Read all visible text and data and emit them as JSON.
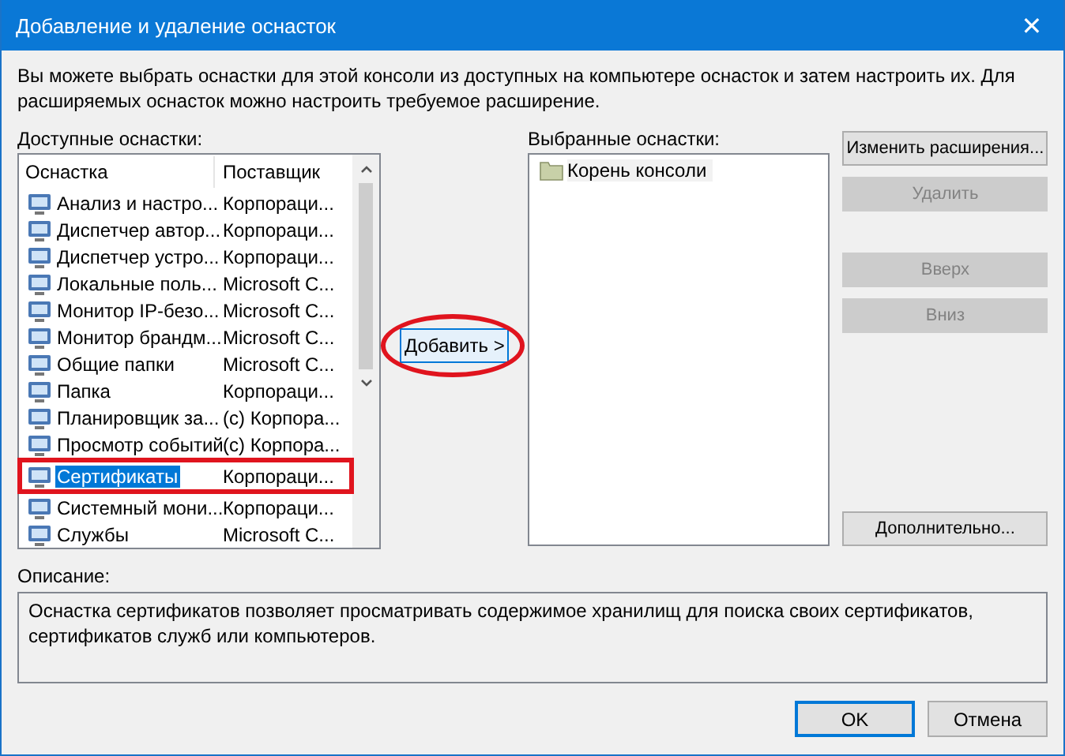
{
  "window": {
    "title": "Добавление и удаление оснасток",
    "close": "✕"
  },
  "intro": "Вы можете выбрать оснастки для этой консоли из доступных на компьютере оснасток и затем настроить их. Для расширяемых оснасток можно настроить требуемое расширение.",
  "available": {
    "label": "Доступные оснастки:",
    "columns": [
      "Оснастка",
      "Поставщик"
    ],
    "rows": [
      {
        "name": "Анализ и настро...",
        "vendor": "Корпораци...",
        "selected": false,
        "highlighted": false
      },
      {
        "name": "Диспетчер автор...",
        "vendor": "Корпораци...",
        "selected": false,
        "highlighted": false
      },
      {
        "name": "Диспетчер устро...",
        "vendor": "Корпораци...",
        "selected": false,
        "highlighted": false
      },
      {
        "name": "Локальные поль...",
        "vendor": "Microsoft C...",
        "selected": false,
        "highlighted": false
      },
      {
        "name": "Монитор IP-безо...",
        "vendor": "Microsoft C...",
        "selected": false,
        "highlighted": false
      },
      {
        "name": "Монитор брандм...",
        "vendor": "Microsoft C...",
        "selected": false,
        "highlighted": false
      },
      {
        "name": "Общие папки",
        "vendor": "Microsoft C...",
        "selected": false,
        "highlighted": false
      },
      {
        "name": "Папка",
        "vendor": "Корпораци...",
        "selected": false,
        "highlighted": false
      },
      {
        "name": "Планировщик за...",
        "vendor": "(c) Корпора...",
        "selected": false,
        "highlighted": false
      },
      {
        "name": "Просмотр событий",
        "vendor": "(c) Корпора...",
        "selected": false,
        "highlighted": false
      },
      {
        "name": "Сертификаты",
        "vendor": "Корпораци...",
        "selected": true,
        "highlighted": true
      },
      {
        "name": "Системный мони...",
        "vendor": "Корпораци...",
        "selected": false,
        "highlighted": false
      },
      {
        "name": "Службы",
        "vendor": "Microsoft C...",
        "selected": false,
        "highlighted": false
      }
    ]
  },
  "add_button": {
    "label": "Добавить >",
    "highlighted": true
  },
  "selected_snapins": {
    "label": "Выбранные оснастки:",
    "items": [
      "Корень консоли"
    ]
  },
  "side_buttons": [
    {
      "label": "Изменить расширения...",
      "disabled": false
    },
    {
      "label": "Удалить",
      "disabled": true
    },
    {
      "label": "Вверх",
      "disabled": true
    },
    {
      "label": "Вниз",
      "disabled": true
    }
  ],
  "advanced_button": {
    "label": "Дополнительно...",
    "disabled": false
  },
  "description": {
    "label": "Описание:",
    "text": "Оснастка сертификатов позволяет просматривать содержимое хранилищ для поиска своих сертификатов, сертификатов служб или компьютеров."
  },
  "buttons": [
    {
      "label": "OK",
      "default": true
    },
    {
      "label": "Отмена",
      "default": false
    }
  ]
}
